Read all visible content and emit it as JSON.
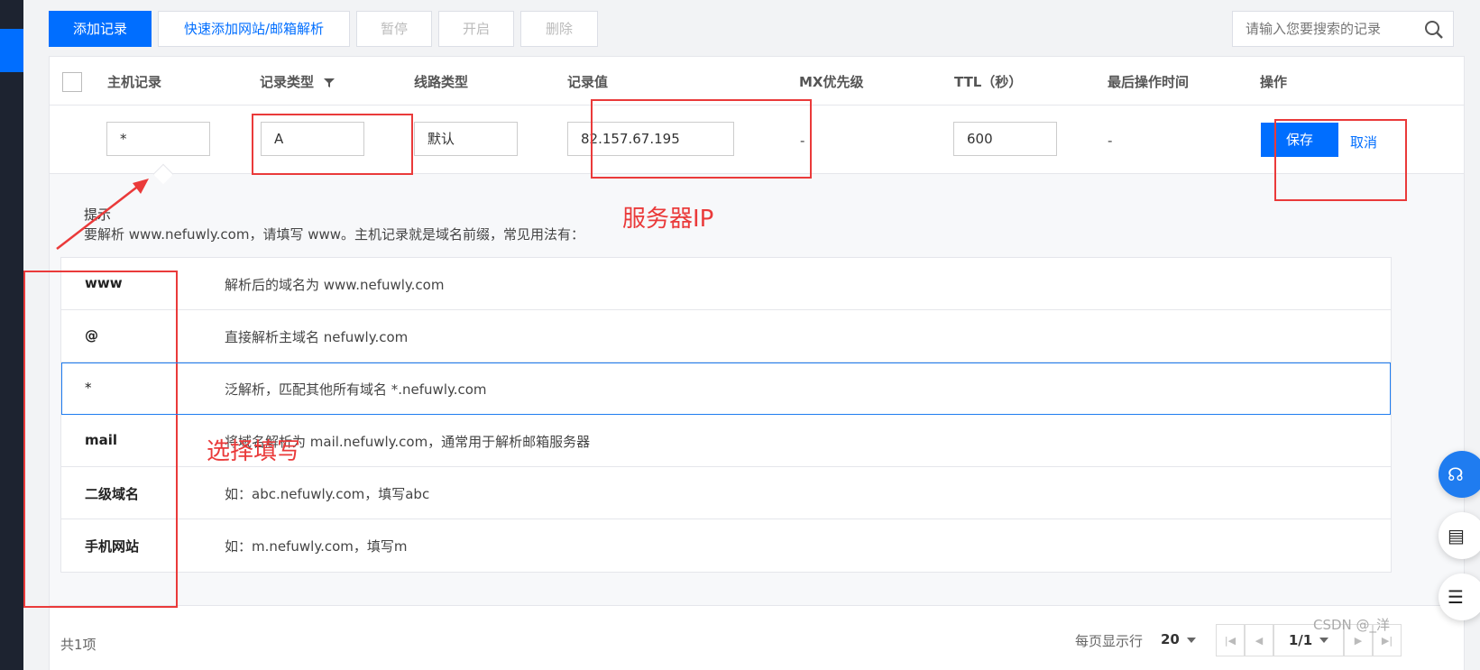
{
  "toolbar": {
    "add_label": "添加记录",
    "quick_add_label": "快速添加网站/邮箱解析",
    "pause_label": "暂停",
    "enable_label": "开启",
    "delete_label": "删除"
  },
  "search": {
    "placeholder": "请输入您要搜索的记录"
  },
  "table": {
    "headers": {
      "host": "主机记录",
      "type": "记录类型",
      "line": "线路类型",
      "value": "记录值",
      "mx": "MX优先级",
      "ttl": "TTL（秒）",
      "last_op": "最后操作时间",
      "action": "操作"
    },
    "edit_row": {
      "host": "*",
      "type": "A",
      "line": "默认",
      "value": "82.157.67.195",
      "mx": "-",
      "ttl": "600",
      "last_op": "-",
      "save": "保存",
      "cancel": "取消"
    }
  },
  "tip": {
    "title": "提示",
    "desc": "要解析 www.nefuwly.com，请填写 www。主机记录就是域名前缀，常见用法有：",
    "rows": [
      {
        "key": "www",
        "val": "解析后的域名为 www.nefuwly.com"
      },
      {
        "key": "@",
        "val": "直接解析主域名 nefuwly.com"
      },
      {
        "key": "*",
        "val": "泛解析，匹配其他所有域名 *.nefuwly.com"
      },
      {
        "key": "mail",
        "val": "将域名解析为 mail.nefuwly.com，通常用于解析邮箱服务器"
      },
      {
        "key": "二级域名",
        "val": "如：abc.nefuwly.com，填写abc"
      },
      {
        "key": "手机网站",
        "val": "如：m.nefuwly.com，填写m"
      }
    ]
  },
  "footer": {
    "total": "共1项",
    "per_page_label": "每页显示行",
    "per_page": "20",
    "page": "1/1"
  },
  "annotations": {
    "server_ip": "服务器IP",
    "choose_fill": "选择填写"
  },
  "watermark": "CSDN @_洋",
  "colors": {
    "primary": "#006eff",
    "annotation": "#ea3a3a",
    "sidebar": "#1d2330"
  }
}
